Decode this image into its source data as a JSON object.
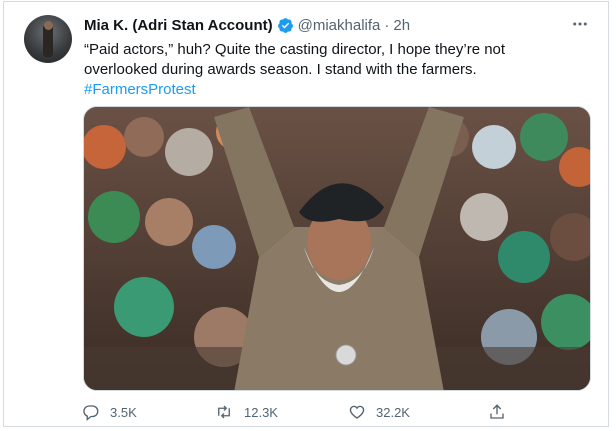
{
  "tweet": {
    "author_name": "Mia K. (Adri Stan Account)",
    "handle": "@miakhalifa",
    "separator": "·",
    "time": "2h",
    "text_lines": [
      "“Paid actors,” huh? Quite the casting director, I hope they’re not",
      "overlooked during awards season. I stand with the farmers."
    ],
    "hashtag": "#FarmersProtest",
    "media_description_icon": "photo-of-protest-crowd",
    "stats": {
      "replies": "3.5K",
      "retweets": "12.3K",
      "likes": "32.2K"
    }
  },
  "colors": {
    "accent": "#1d9bf0",
    "secondary_text": "#536471",
    "verified_badge": "#1d9bf0"
  },
  "icons": [
    "verified-icon",
    "more-icon",
    "reply-icon",
    "retweet-icon",
    "like-icon",
    "share-icon"
  ]
}
